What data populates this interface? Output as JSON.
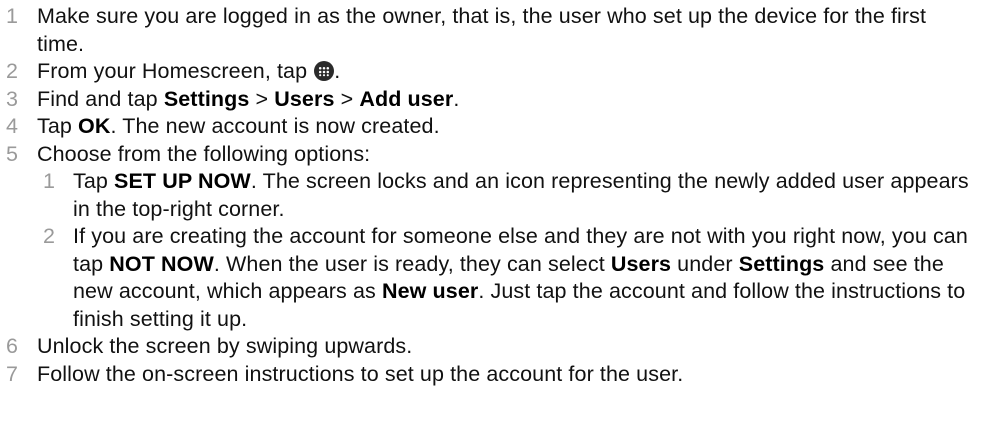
{
  "steps": [
    {
      "number": "1",
      "text": "Make sure you are logged in as the owner, that is, the user who set up the device for the first time."
    },
    {
      "number": "2",
      "text_before": "From your Homescreen, tap ",
      "icon": "apps-grid-icon",
      "text_after": "."
    },
    {
      "number": "3",
      "text_before": "Find and tap ",
      "bold_1": "Settings",
      "sep_1": " > ",
      "bold_2": "Users",
      "sep_2": " > ",
      "bold_3": "Add user",
      "text_after": "."
    },
    {
      "number": "4",
      "text_before": "Tap ",
      "bold_1": "OK",
      "text_after": ". The new account is now created."
    },
    {
      "number": "5",
      "text": "Choose from the following options:",
      "substeps": [
        {
          "number": "1",
          "text_before": "Tap ",
          "bold_1": "SET UP NOW",
          "text_after": ". The screen locks and an icon representing the newly added user appears in the top-right corner."
        },
        {
          "number": "2",
          "text_before": "If you are creating the account for someone else and they are not with you right now, you can tap ",
          "bold_1": "NOT NOW",
          "text_mid_1": ". When the user is ready, they can select ",
          "bold_2": "Users",
          "text_mid_2": " under ",
          "bold_3": "Settings",
          "text_mid_3": " and see the new account, which appears as ",
          "bold_4": "New user",
          "text_after": ". Just tap the account and follow the instructions to finish setting it up."
        }
      ]
    },
    {
      "number": "6",
      "text": "Unlock the screen by swiping upwards."
    },
    {
      "number": "7",
      "text": "Follow the on-screen instructions to set up the account for the user."
    }
  ]
}
